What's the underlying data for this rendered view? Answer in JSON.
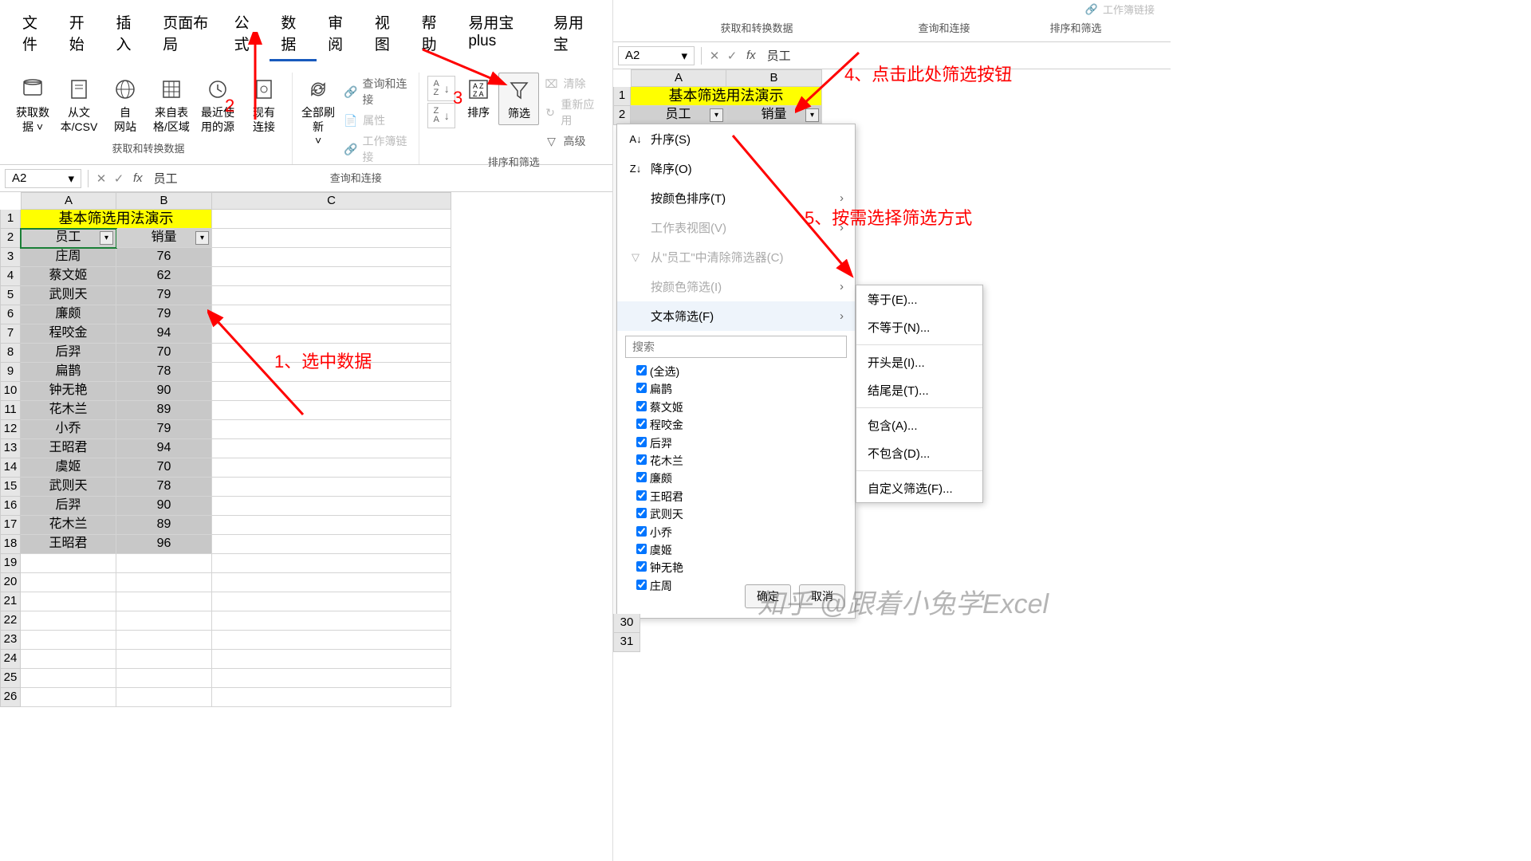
{
  "menubar": [
    "文件",
    "开始",
    "插入",
    "页面布局",
    "公式",
    "数据",
    "审阅",
    "视图",
    "帮助",
    "易用宝 plus",
    "易用宝"
  ],
  "active_menu": "数据",
  "ribbon": {
    "g1": {
      "label": "获取和转换数据",
      "btns": [
        "获取数\n据 ˅",
        "从文\n本/CSV",
        "自\n网站",
        "来自表\n格/区域",
        "最近使\n用的源",
        "现有\n连接"
      ]
    },
    "g2": {
      "label": "查询和连接",
      "big": "全部刷新\n˅",
      "small": [
        "查询和连接",
        "属性",
        "工作簿链接"
      ]
    },
    "g3": {
      "label": "排序和筛选",
      "sort1": "A→Z",
      "sort2": "Z→A",
      "sortbtn": "排序",
      "filter": "筛选",
      "small": [
        "清除",
        "重新应用",
        "高级"
      ]
    }
  },
  "namebox": "A2",
  "fx_value": "员工",
  "cols": [
    "A",
    "B",
    "C"
  ],
  "title": "基本筛选用法演示",
  "headers": [
    "员工",
    "销量"
  ],
  "rows": [
    [
      "庄周",
      "76"
    ],
    [
      "蔡文姬",
      "62"
    ],
    [
      "武则天",
      "79"
    ],
    [
      "廉颇",
      "79"
    ],
    [
      "程咬金",
      "94"
    ],
    [
      "后羿",
      "70"
    ],
    [
      "扁鹊",
      "78"
    ],
    [
      "钟无艳",
      "90"
    ],
    [
      "花木兰",
      "89"
    ],
    [
      "小乔",
      "79"
    ],
    [
      "王昭君",
      "94"
    ],
    [
      "虞姬",
      "70"
    ],
    [
      "武则天",
      "78"
    ],
    [
      "后羿",
      "90"
    ],
    [
      "花木兰",
      "89"
    ],
    [
      "王昭君",
      "96"
    ]
  ],
  "extra_row_nums": [
    19,
    20,
    21,
    22,
    23,
    24,
    25,
    26
  ],
  "anno1": "1、选中数据",
  "anno2": "2",
  "anno3": "3",
  "anno4": "4、点击此处筛选按钮",
  "anno5": "5、按需选择筛选方式",
  "right": {
    "ribbon_labels": [
      "获取和转换数据",
      "查询和连接",
      "排序和筛选"
    ],
    "ribbon_hint": "工作簿链接",
    "namebox": "A2",
    "fx_value": "员工",
    "cols": [
      "A",
      "B"
    ],
    "title": "基本筛选用法演示",
    "headers": [
      "员工",
      "销量"
    ],
    "row_nums_bottom": [
      "30",
      "31"
    ]
  },
  "dropdown": {
    "sort_asc": "升序(S)",
    "sort_desc": "降序(O)",
    "sort_color": "按颜色排序(T)",
    "sheet_view": "工作表视图(V)",
    "clear_filter": "从\"员工\"中清除筛选器(C)",
    "filter_color": "按颜色筛选(I)",
    "text_filter": "文本筛选(F)",
    "search_ph": "搜索",
    "select_all": "(全选)",
    "items": [
      "扁鹊",
      "蔡文姬",
      "程咬金",
      "后羿",
      "花木兰",
      "廉颇",
      "王昭君",
      "武则天",
      "小乔",
      "虞姬",
      "钟无艳",
      "庄周"
    ],
    "ok": "确定",
    "cancel": "取消"
  },
  "submenu": [
    "等于(E)...",
    "不等于(N)...",
    "开头是(I)...",
    "结尾是(T)...",
    "包含(A)...",
    "不包含(D)...",
    "自定义筛选(F)..."
  ],
  "watermark": "知乎 @跟着小兔学Excel"
}
